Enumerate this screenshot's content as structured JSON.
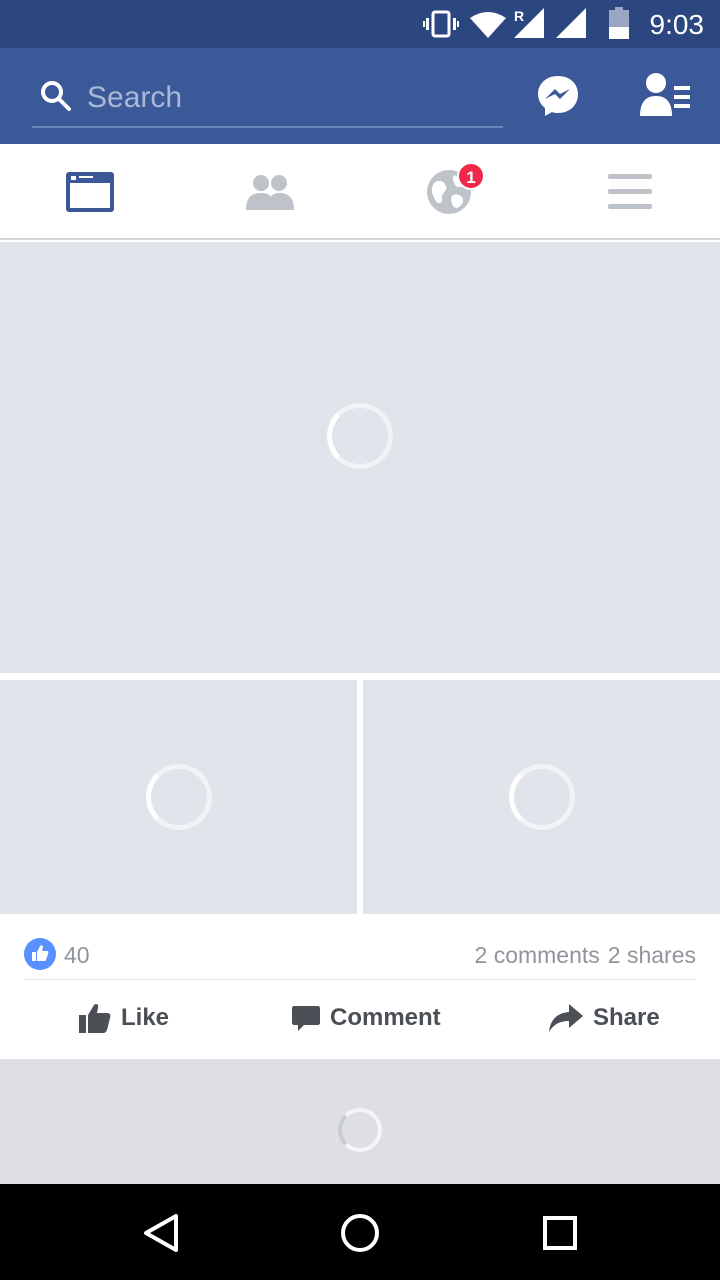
{
  "status_bar": {
    "time": "9:03",
    "roaming_indicator": "R",
    "icons": [
      "vibrate-icon",
      "wifi-icon",
      "roaming-signal-icon",
      "signal-icon",
      "battery-icon"
    ]
  },
  "app_bar": {
    "search": {
      "placeholder": "Search",
      "value": ""
    },
    "colors": {
      "brand": "#3b5998",
      "status_bar": "#2c4680"
    }
  },
  "tabs": [
    {
      "name": "news-feed",
      "active": true
    },
    {
      "name": "friend-requests",
      "active": false
    },
    {
      "name": "notifications",
      "active": false,
      "badge": "1"
    },
    {
      "name": "more-menu",
      "active": false
    }
  ],
  "post": {
    "like_count": "40",
    "comments": "2 comments",
    "shares": "2 shares",
    "actions": {
      "like": "Like",
      "comment": "Comment",
      "share": "Share"
    }
  }
}
